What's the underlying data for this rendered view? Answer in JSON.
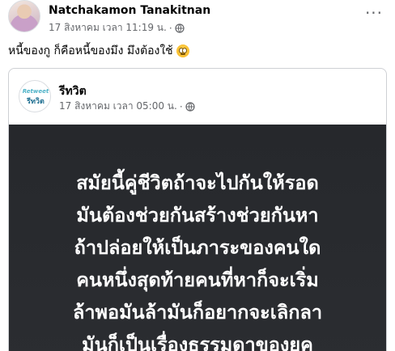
{
  "post": {
    "author": "Natchakamon Tanakitnan",
    "timestamp": "17 สิงหาคม เวลา 11:19 น.",
    "separator": "·",
    "more_label": "···",
    "caption": "หนี้ของกู ก็คือหนี้ของมึง มึงต้องใช้",
    "caption_emoji": "eye-roll-emoji"
  },
  "shared": {
    "page_name": "รีทวิต",
    "page_logo_top": "Retweet",
    "page_logo_bottom": "รีทวิต",
    "timestamp": "17 สิงหาคม เวลา 05:00 น.",
    "separator": "·",
    "image_lines": [
      "สมัยนี้คู่ชีวิตถ้าจะไปกันให้รอด",
      "มันต้องช่วยกันสร้างช่วยกันหา",
      "ถ้าปล่อยให้เป็นภาระของคนใด",
      "คนหนึ่งสุดท้ายคนที่หาก็จะเริ่ม",
      "ล้าพอมันล้ามันก็อยากจะเลิกลา",
      "มันก็เป็นเรื่องธรรมดาของยุค"
    ]
  },
  "colors": {
    "text_primary": "#050505",
    "text_secondary": "#65676b",
    "card_border": "#ced0d4",
    "image_background": "#2a2c30"
  }
}
